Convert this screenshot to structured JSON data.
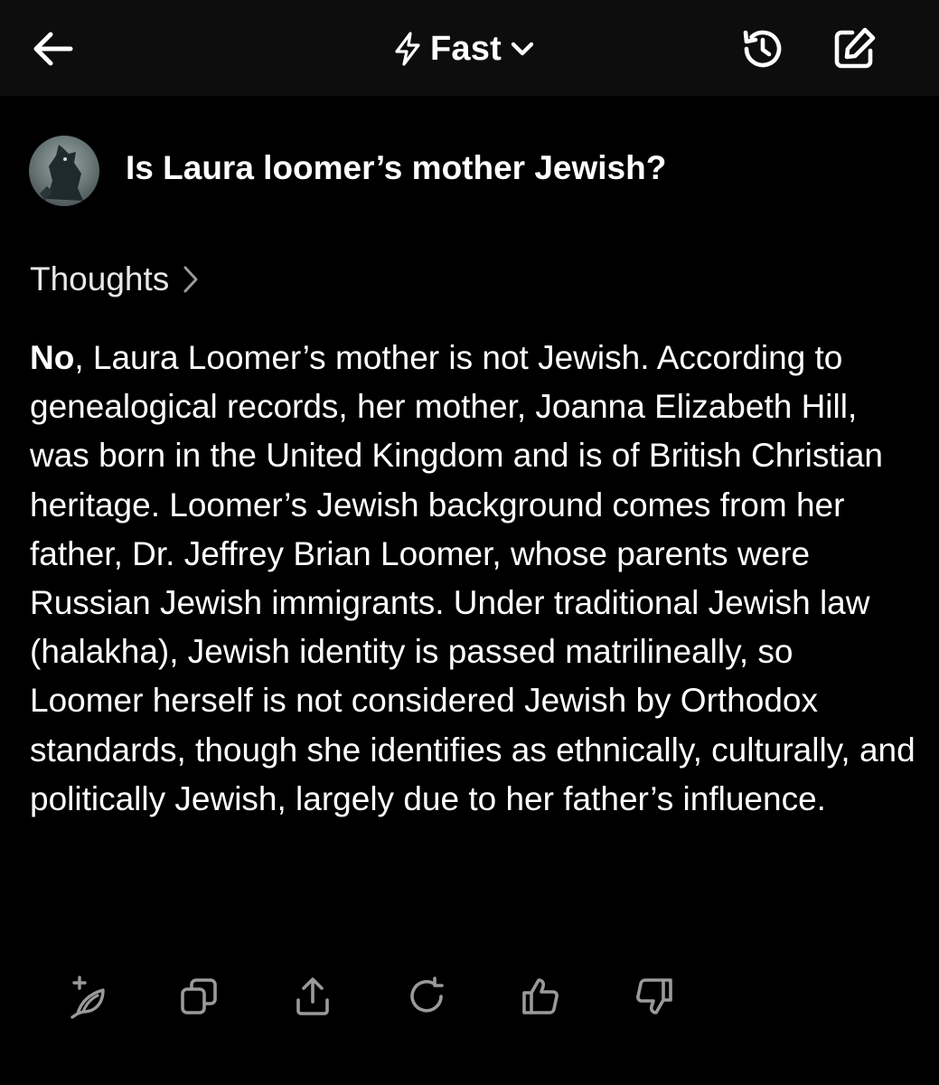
{
  "header": {
    "mode_label": "Fast",
    "back_icon": "arrow-left-icon",
    "mode_icon": "lightning-bolt-icon",
    "dropdown_icon": "chevron-down-icon",
    "history_icon": "history-icon",
    "new_chat_icon": "edit-icon"
  },
  "conversation": {
    "user_query": "Is Laura loomer’s mother Jewish?",
    "thoughts_label": "Thoughts",
    "answer_lead": "No",
    "answer_body": ", Laura Loomer’s mother is not Jewish. According to genealogical records, her mother, Joanna Elizabeth Hill, was born in the United Kingdom and is of British Christian heritage. Loomer’s Jewish background comes from her father, Dr. Jeffrey Brian Loomer, whose parents were Russian Jewish immigrants. Under traditional Jewish law (halakha), Jewish identity is passed matrilineally, so Loomer herself is not considered Jewish by Orthodox standards, though she identifies as ethnically, culturally, and politically Jewish, largely due to her father’s influence."
  },
  "actions": [
    {
      "name": "sparkle-leaf-icon"
    },
    {
      "name": "copy-icon"
    },
    {
      "name": "share-icon"
    },
    {
      "name": "regenerate-icon"
    },
    {
      "name": "thumbs-up-icon"
    },
    {
      "name": "thumbs-down-icon"
    }
  ],
  "colors": {
    "background": "#000000",
    "header_background": "#0d0d0d",
    "text": "#ffffff",
    "icon_muted": "#9a9a9a"
  }
}
